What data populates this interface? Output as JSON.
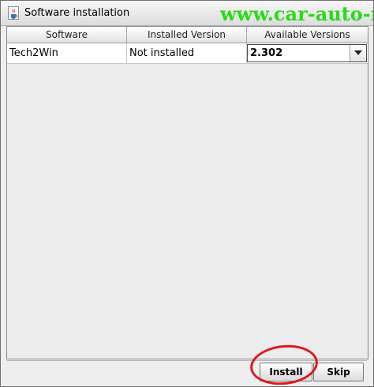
{
  "window": {
    "title": "Software installation",
    "icon": "java-coffee-cup-icon"
  },
  "watermark": "www.car-auto-repair.c",
  "table": {
    "columns": [
      "Software",
      "Installed Version",
      "Available Versions"
    ],
    "rows": [
      {
        "software": "Tech2Win",
        "installed_version": "Not installed",
        "available_version": "2.302"
      }
    ]
  },
  "buttons": {
    "install": "Install",
    "skip": "Skip"
  },
  "colors": {
    "watermark": "#2bd91a",
    "highlight_circle": "#e1171e"
  }
}
